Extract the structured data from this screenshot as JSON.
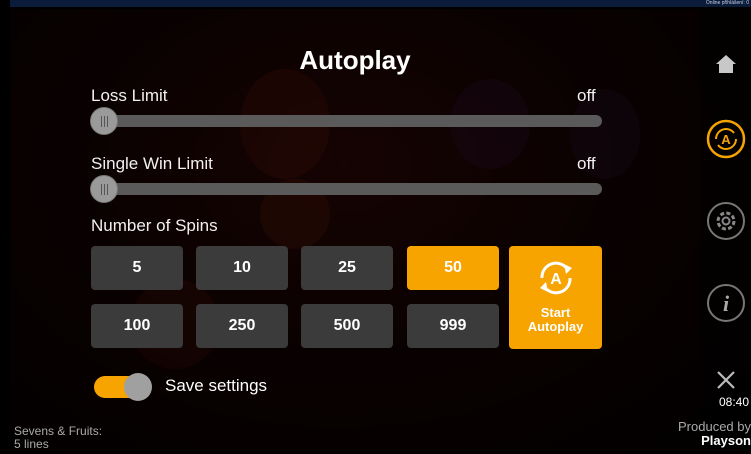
{
  "top_notice": "Online přihlášení: 0",
  "title": "Autoplay",
  "loss_limit": {
    "label": "Loss Limit",
    "value": "off"
  },
  "single_win_limit": {
    "label": "Single Win Limit",
    "value": "off"
  },
  "number_of_spins": {
    "label": "Number of Spins",
    "options": [
      "5",
      "10",
      "25",
      "50",
      "100",
      "250",
      "500",
      "999"
    ],
    "selected": "50"
  },
  "start_button": {
    "line1": "Start",
    "line2": "Autoplay"
  },
  "save_settings": {
    "label": "Save settings",
    "enabled": true
  },
  "sidebar": {
    "icons": [
      "home-icon",
      "autoplay-icon",
      "settings-gear-icon",
      "info-icon",
      "close-icon"
    ]
  },
  "clock": "08:40",
  "footer_left": {
    "line1": "Sevens & Fruits:",
    "line2": "5 lines"
  },
  "footer_right": {
    "line1": "Produced by",
    "line2": "Playson"
  },
  "colors": {
    "accent": "#f7a300",
    "button": "#3b3b3b",
    "track": "#5a5a5a"
  }
}
